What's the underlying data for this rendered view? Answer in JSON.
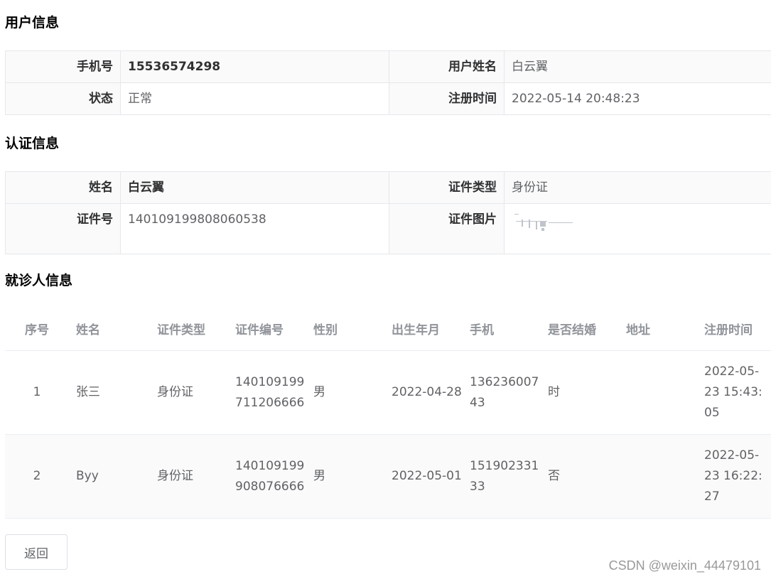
{
  "sections": {
    "user": "用户信息",
    "auth": "认证信息",
    "patients": "就诊人信息"
  },
  "user_info": {
    "phone_label": "手机号",
    "phone": "15536574298",
    "name_label": "用户姓名",
    "name": "白云翼",
    "status_label": "状态",
    "status": "正常",
    "reg_label": "注册时间",
    "reg_time": "2022-05-14 20:48:23"
  },
  "auth_info": {
    "name_label": "姓名",
    "name": "白云翼",
    "cert_type_label": "证件类型",
    "cert_type": "身份证",
    "cert_no_label": "证件号",
    "cert_no": "140109199808060538",
    "cert_img_label": "证件图片"
  },
  "patients": {
    "headers": [
      "序号",
      "姓名",
      "证件类型",
      "证件编号",
      "性别",
      "出生年月",
      "手机",
      "是否结婚",
      "地址",
      "注册时间"
    ],
    "rows": [
      [
        "1",
        "张三",
        "身份证",
        "140109199711206666",
        "男",
        "2022-04-28",
        "13623600743",
        "时",
        "",
        "2022-05-23 15:43:05"
      ],
      [
        "2",
        "Byy",
        "身份证",
        "140109199908076666",
        "男",
        "2022-05-01",
        "15190233133",
        "否",
        "",
        "2022-05-23 16:22:27"
      ]
    ]
  },
  "back_button": "返回",
  "watermark": "CSDN @weixin_44479101"
}
